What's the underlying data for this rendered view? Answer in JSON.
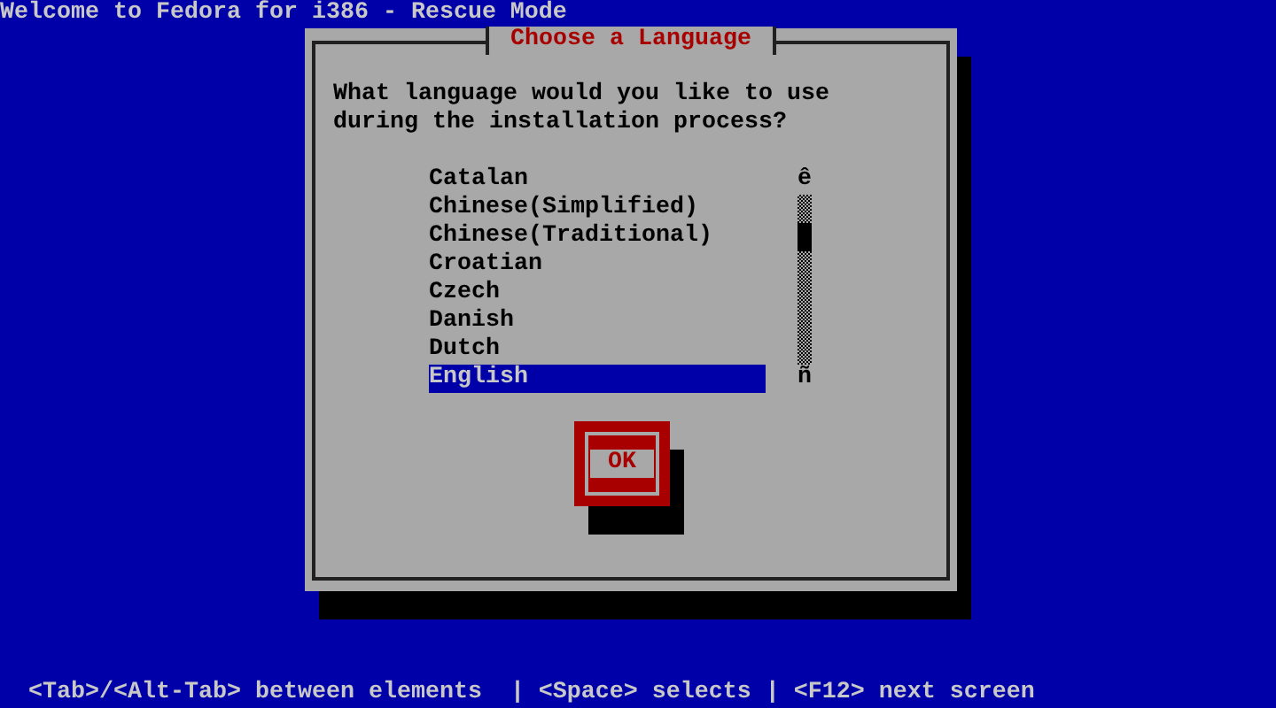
{
  "title_bar": {
    "text": "Welcome to Fedora for i386 - Rescue Mode"
  },
  "dialog": {
    "title": "Choose a Language",
    "prompt_lines": [
      "What language would you like to use",
      "during the installation process?"
    ],
    "languages": [
      {
        "label": "Catalan",
        "selected": false
      },
      {
        "label": "Chinese(Simplified)",
        "selected": false
      },
      {
        "label": "Chinese(Traditional)",
        "selected": false
      },
      {
        "label": "Croatian",
        "selected": false
      },
      {
        "label": "Czech",
        "selected": false
      },
      {
        "label": "Danish",
        "selected": false
      },
      {
        "label": "Dutch",
        "selected": false
      },
      {
        "label": "English",
        "selected": true
      }
    ],
    "scrollbar": {
      "up_arrow": "ê",
      "down_arrow": "ñ"
    },
    "ok_button": {
      "label": "OK"
    }
  },
  "help_line": "<Tab>/<Alt-Tab> between elements  | <Space> selects | <F12> next screen"
}
